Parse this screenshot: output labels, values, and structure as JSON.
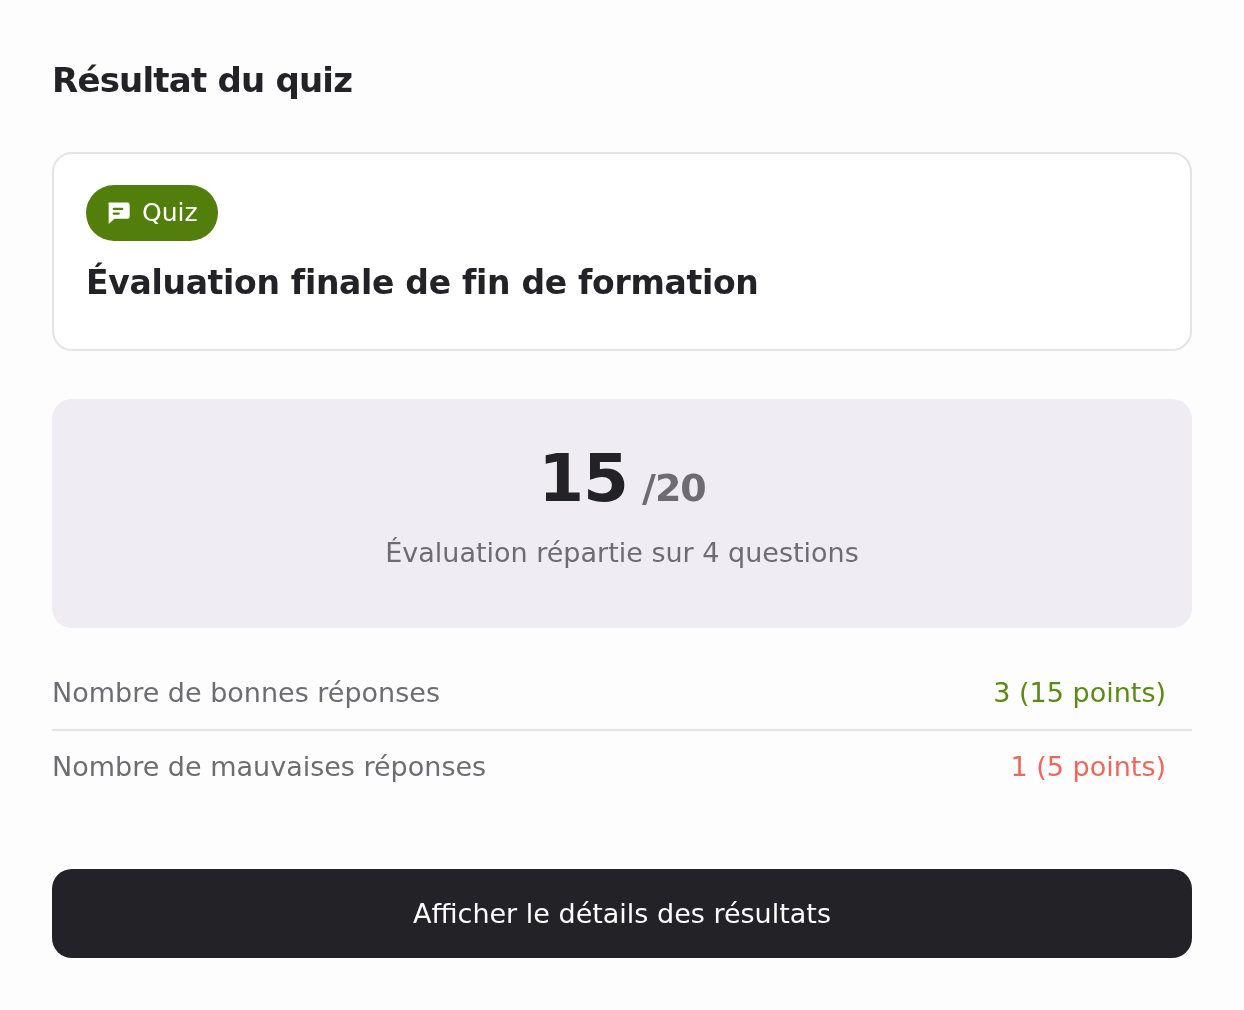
{
  "page": {
    "title": "Résultat du quiz"
  },
  "quiz_card": {
    "badge": "Quiz",
    "title": "Évaluation finale de fin de formation"
  },
  "score": {
    "value": "15",
    "total": "/20",
    "caption": "Évaluation répartie sur 4 questions"
  },
  "stats": [
    {
      "label": "Nombre de bonnes réponses",
      "value": "3 (15 points)",
      "color": "#5a8c12"
    },
    {
      "label": "Nombre de mauvaises réponses",
      "value": "1 (5 points)",
      "color": "#f2665a"
    }
  ],
  "button": {
    "label": "Afficher le détails des résultats"
  }
}
